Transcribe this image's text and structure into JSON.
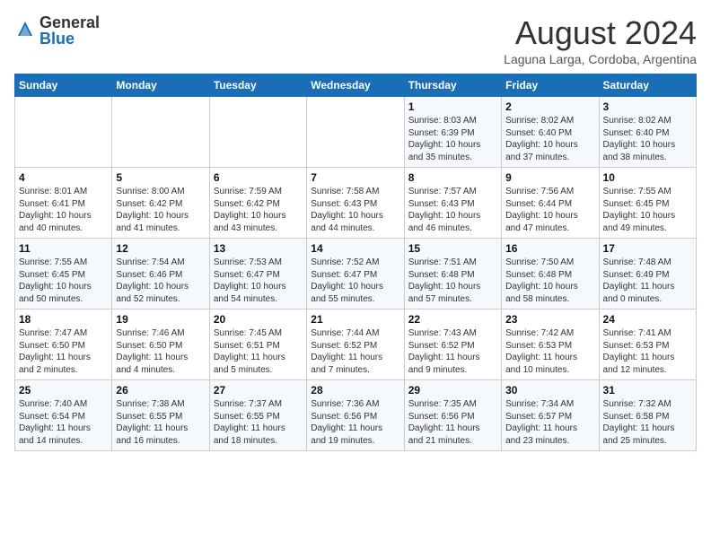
{
  "header": {
    "logo_general": "General",
    "logo_blue": "Blue",
    "month_year": "August 2024",
    "location": "Laguna Larga, Cordoba, Argentina"
  },
  "days_of_week": [
    "Sunday",
    "Monday",
    "Tuesday",
    "Wednesday",
    "Thursday",
    "Friday",
    "Saturday"
  ],
  "weeks": [
    [
      {
        "day": "",
        "info": ""
      },
      {
        "day": "",
        "info": ""
      },
      {
        "day": "",
        "info": ""
      },
      {
        "day": "",
        "info": ""
      },
      {
        "day": "1",
        "info": "Sunrise: 8:03 AM\nSunset: 6:39 PM\nDaylight: 10 hours\nand 35 minutes."
      },
      {
        "day": "2",
        "info": "Sunrise: 8:02 AM\nSunset: 6:40 PM\nDaylight: 10 hours\nand 37 minutes."
      },
      {
        "day": "3",
        "info": "Sunrise: 8:02 AM\nSunset: 6:40 PM\nDaylight: 10 hours\nand 38 minutes."
      }
    ],
    [
      {
        "day": "4",
        "info": "Sunrise: 8:01 AM\nSunset: 6:41 PM\nDaylight: 10 hours\nand 40 minutes."
      },
      {
        "day": "5",
        "info": "Sunrise: 8:00 AM\nSunset: 6:42 PM\nDaylight: 10 hours\nand 41 minutes."
      },
      {
        "day": "6",
        "info": "Sunrise: 7:59 AM\nSunset: 6:42 PM\nDaylight: 10 hours\nand 43 minutes."
      },
      {
        "day": "7",
        "info": "Sunrise: 7:58 AM\nSunset: 6:43 PM\nDaylight: 10 hours\nand 44 minutes."
      },
      {
        "day": "8",
        "info": "Sunrise: 7:57 AM\nSunset: 6:43 PM\nDaylight: 10 hours\nand 46 minutes."
      },
      {
        "day": "9",
        "info": "Sunrise: 7:56 AM\nSunset: 6:44 PM\nDaylight: 10 hours\nand 47 minutes."
      },
      {
        "day": "10",
        "info": "Sunrise: 7:55 AM\nSunset: 6:45 PM\nDaylight: 10 hours\nand 49 minutes."
      }
    ],
    [
      {
        "day": "11",
        "info": "Sunrise: 7:55 AM\nSunset: 6:45 PM\nDaylight: 10 hours\nand 50 minutes."
      },
      {
        "day": "12",
        "info": "Sunrise: 7:54 AM\nSunset: 6:46 PM\nDaylight: 10 hours\nand 52 minutes."
      },
      {
        "day": "13",
        "info": "Sunrise: 7:53 AM\nSunset: 6:47 PM\nDaylight: 10 hours\nand 54 minutes."
      },
      {
        "day": "14",
        "info": "Sunrise: 7:52 AM\nSunset: 6:47 PM\nDaylight: 10 hours\nand 55 minutes."
      },
      {
        "day": "15",
        "info": "Sunrise: 7:51 AM\nSunset: 6:48 PM\nDaylight: 10 hours\nand 57 minutes."
      },
      {
        "day": "16",
        "info": "Sunrise: 7:50 AM\nSunset: 6:48 PM\nDaylight: 10 hours\nand 58 minutes."
      },
      {
        "day": "17",
        "info": "Sunrise: 7:48 AM\nSunset: 6:49 PM\nDaylight: 11 hours\nand 0 minutes."
      }
    ],
    [
      {
        "day": "18",
        "info": "Sunrise: 7:47 AM\nSunset: 6:50 PM\nDaylight: 11 hours\nand 2 minutes."
      },
      {
        "day": "19",
        "info": "Sunrise: 7:46 AM\nSunset: 6:50 PM\nDaylight: 11 hours\nand 4 minutes."
      },
      {
        "day": "20",
        "info": "Sunrise: 7:45 AM\nSunset: 6:51 PM\nDaylight: 11 hours\nand 5 minutes."
      },
      {
        "day": "21",
        "info": "Sunrise: 7:44 AM\nSunset: 6:52 PM\nDaylight: 11 hours\nand 7 minutes."
      },
      {
        "day": "22",
        "info": "Sunrise: 7:43 AM\nSunset: 6:52 PM\nDaylight: 11 hours\nand 9 minutes."
      },
      {
        "day": "23",
        "info": "Sunrise: 7:42 AM\nSunset: 6:53 PM\nDaylight: 11 hours\nand 10 minutes."
      },
      {
        "day": "24",
        "info": "Sunrise: 7:41 AM\nSunset: 6:53 PM\nDaylight: 11 hours\nand 12 minutes."
      }
    ],
    [
      {
        "day": "25",
        "info": "Sunrise: 7:40 AM\nSunset: 6:54 PM\nDaylight: 11 hours\nand 14 minutes."
      },
      {
        "day": "26",
        "info": "Sunrise: 7:38 AM\nSunset: 6:55 PM\nDaylight: 11 hours\nand 16 minutes."
      },
      {
        "day": "27",
        "info": "Sunrise: 7:37 AM\nSunset: 6:55 PM\nDaylight: 11 hours\nand 18 minutes."
      },
      {
        "day": "28",
        "info": "Sunrise: 7:36 AM\nSunset: 6:56 PM\nDaylight: 11 hours\nand 19 minutes."
      },
      {
        "day": "29",
        "info": "Sunrise: 7:35 AM\nSunset: 6:56 PM\nDaylight: 11 hours\nand 21 minutes."
      },
      {
        "day": "30",
        "info": "Sunrise: 7:34 AM\nSunset: 6:57 PM\nDaylight: 11 hours\nand 23 minutes."
      },
      {
        "day": "31",
        "info": "Sunrise: 7:32 AM\nSunset: 6:58 PM\nDaylight: 11 hours\nand 25 minutes."
      }
    ]
  ]
}
